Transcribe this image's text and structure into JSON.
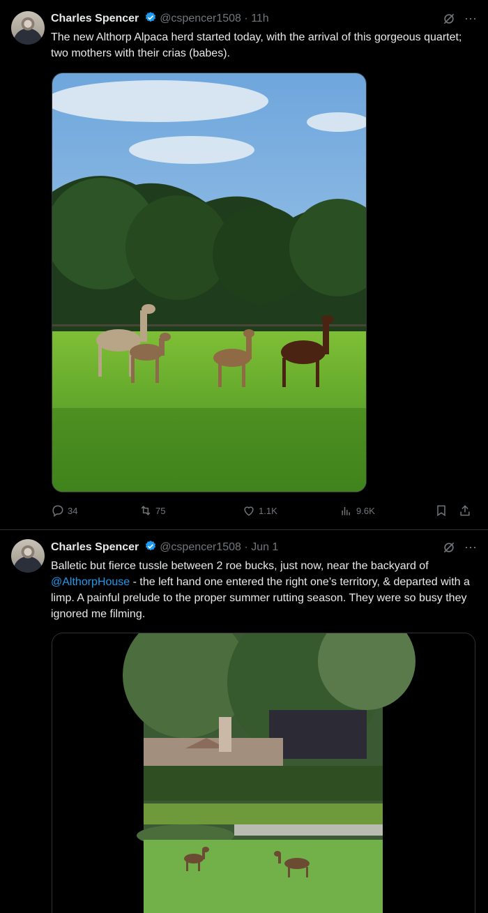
{
  "tweets": [
    {
      "author": "Charles Spencer",
      "handle": "@cspencer1508",
      "separator": "·",
      "time": "11h",
      "text": "The new Althorp Alpaca herd started today, with the arrival of this gorgeous quartet; two mothers with their crias (babes).",
      "stats": {
        "replies": "34",
        "reposts": "75",
        "likes": "1.1K",
        "views": "9.6K"
      }
    },
    {
      "author": "Charles Spencer",
      "handle": "@cspencer1508",
      "separator": "·",
      "time": "Jun 1",
      "text_before_mention": "Balletic but fierce tussle between 2 roe bucks, just now, near the backyard of ",
      "mention": "@AlthorpHouse",
      "text_after_mention": " - the left hand one entered the right one’s territory, & departed with a limp. A painful prelude to the proper summer rutting season. They were so busy they ignored me filming."
    }
  ],
  "icons": {
    "more": "⋯",
    "grok": "grok-icon",
    "verified_color": "#1d9bf0",
    "muted_color": "#71767b",
    "link_color": "#1d9bf0"
  }
}
